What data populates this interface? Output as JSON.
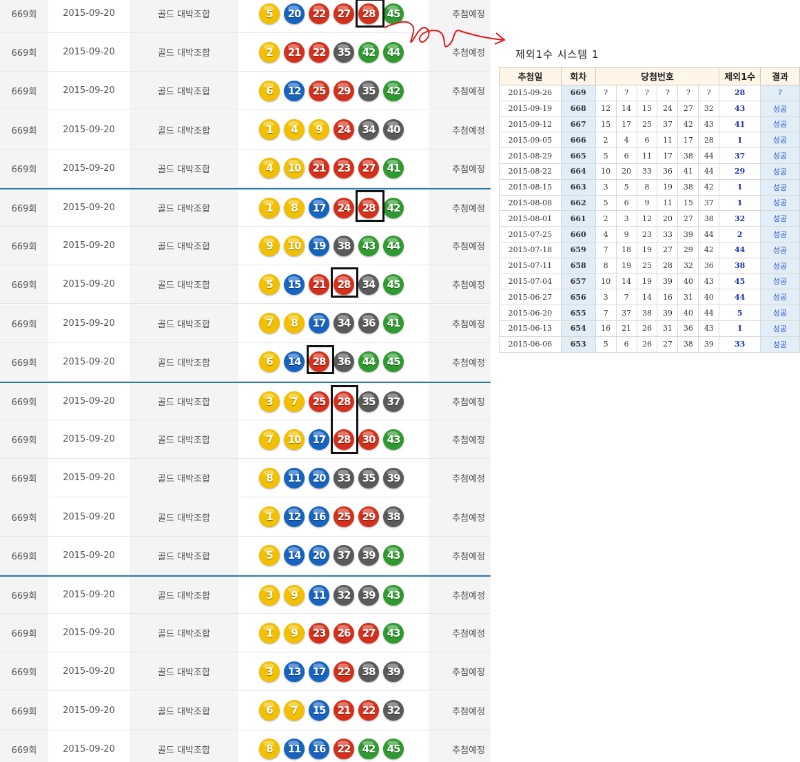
{
  "left_list": {
    "rows": [
      {
        "round": "669회",
        "date": "2015-09-20",
        "name": "골드 대박조합",
        "status": "추첨예정",
        "balls": [
          5,
          20,
          22,
          27,
          28,
          45
        ]
      },
      {
        "round": "669회",
        "date": "2015-09-20",
        "name": "골드 대박조합",
        "status": "추첨예정",
        "balls": [
          2,
          21,
          22,
          35,
          42,
          44
        ]
      },
      {
        "round": "669회",
        "date": "2015-09-20",
        "name": "골드 대박조합",
        "status": "추첨예정",
        "balls": [
          6,
          12,
          25,
          29,
          35,
          42
        ]
      },
      {
        "round": "669회",
        "date": "2015-09-20",
        "name": "골드 대박조합",
        "status": "추첨예정",
        "balls": [
          1,
          4,
          9,
          24,
          34,
          40
        ]
      },
      {
        "round": "669회",
        "date": "2015-09-20",
        "name": "골드 대박조합",
        "status": "추첨예정",
        "balls": [
          4,
          10,
          21,
          23,
          27,
          41
        ]
      },
      {
        "round": "669회",
        "date": "2015-09-20",
        "name": "골드 대박조합",
        "status": "추첨예정",
        "balls": [
          1,
          8,
          17,
          24,
          28,
          42
        ]
      },
      {
        "round": "669회",
        "date": "2015-09-20",
        "name": "골드 대박조합",
        "status": "추첨예정",
        "balls": [
          9,
          10,
          19,
          38,
          43,
          44
        ]
      },
      {
        "round": "669회",
        "date": "2015-09-20",
        "name": "골드 대박조합",
        "status": "추첨예정",
        "balls": [
          5,
          15,
          21,
          28,
          34,
          45
        ]
      },
      {
        "round": "669회",
        "date": "2015-09-20",
        "name": "골드 대박조합",
        "status": "추첨예정",
        "balls": [
          7,
          8,
          17,
          34,
          36,
          41
        ]
      },
      {
        "round": "669회",
        "date": "2015-09-20",
        "name": "골드 대박조합",
        "status": "추첨예정",
        "balls": [
          6,
          14,
          28,
          36,
          44,
          45
        ]
      },
      {
        "round": "669회",
        "date": "2015-09-20",
        "name": "골드 대박조합",
        "status": "추첨예정",
        "balls": [
          3,
          7,
          25,
          28,
          35,
          37
        ]
      },
      {
        "round": "669회",
        "date": "2015-09-20",
        "name": "골드 대박조합",
        "status": "추첨예정",
        "balls": [
          7,
          10,
          17,
          28,
          30,
          43
        ]
      },
      {
        "round": "669회",
        "date": "2015-09-20",
        "name": "골드 대박조합",
        "status": "추첨예정",
        "balls": [
          8,
          11,
          20,
          33,
          35,
          39
        ]
      },
      {
        "round": "669회",
        "date": "2015-09-20",
        "name": "골드 대박조합",
        "status": "추첨예정",
        "balls": [
          1,
          12,
          16,
          25,
          29,
          38
        ]
      },
      {
        "round": "669회",
        "date": "2015-09-20",
        "name": "골드 대박조합",
        "status": "추첨예정",
        "balls": [
          5,
          14,
          20,
          37,
          39,
          43
        ]
      },
      {
        "round": "669회",
        "date": "2015-09-20",
        "name": "골드 대박조합",
        "status": "추첨예정",
        "balls": [
          3,
          9,
          11,
          32,
          39,
          43
        ]
      },
      {
        "round": "669회",
        "date": "2015-09-20",
        "name": "골드 대박조합",
        "status": "추첨예정",
        "balls": [
          1,
          9,
          23,
          26,
          27,
          43
        ]
      },
      {
        "round": "669회",
        "date": "2015-09-20",
        "name": "골드 대박조합",
        "status": "추첨예정",
        "balls": [
          3,
          13,
          17,
          22,
          38,
          39
        ]
      },
      {
        "round": "669회",
        "date": "2015-09-20",
        "name": "골드 대박조합",
        "status": "추첨예정",
        "balls": [
          6,
          7,
          15,
          21,
          22,
          32
        ]
      },
      {
        "round": "669회",
        "date": "2015-09-20",
        "name": "골드 대박조합",
        "status": "추첨예정",
        "balls": [
          8,
          11,
          16,
          22,
          42,
          45
        ]
      }
    ]
  },
  "ball_colors": {
    "yellow": "#f2c000",
    "blue": "#1664c0",
    "red": "#d4301c",
    "gray": "#5a5a5a",
    "green": "#2f9a2f"
  },
  "panel": {
    "title": "제외1수 시스템 1",
    "headers": {
      "date": "추첨일",
      "round": "회차",
      "numbers": "당첨번호",
      "excluded": "제외1수",
      "result": "결과"
    },
    "rows": [
      {
        "date": "2015-09-26",
        "round": "669",
        "nums": [
          "?",
          "?",
          "?",
          "?",
          "?",
          "?"
        ],
        "excluded": "28",
        "result": "?"
      },
      {
        "date": "2015-09-19",
        "round": "668",
        "nums": [
          "12",
          "14",
          "15",
          "24",
          "27",
          "32"
        ],
        "excluded": "43",
        "result": "성공"
      },
      {
        "date": "2015-09-12",
        "round": "667",
        "nums": [
          "15",
          "17",
          "25",
          "37",
          "42",
          "43"
        ],
        "excluded": "41",
        "result": "성공"
      },
      {
        "date": "2015-09-05",
        "round": "666",
        "nums": [
          "2",
          "4",
          "6",
          "11",
          "17",
          "28"
        ],
        "excluded": "1",
        "result": "성공"
      },
      {
        "date": "2015-08-29",
        "round": "665",
        "nums": [
          "5",
          "6",
          "11",
          "17",
          "38",
          "44"
        ],
        "excluded": "37",
        "result": "성공"
      },
      {
        "date": "2015-08-22",
        "round": "664",
        "nums": [
          "10",
          "20",
          "33",
          "36",
          "41",
          "44"
        ],
        "excluded": "29",
        "result": "성공"
      },
      {
        "date": "2015-08-15",
        "round": "663",
        "nums": [
          "3",
          "5",
          "8",
          "19",
          "38",
          "42"
        ],
        "excluded": "1",
        "result": "성공"
      },
      {
        "date": "2015-08-08",
        "round": "662",
        "nums": [
          "5",
          "6",
          "9",
          "11",
          "15",
          "37"
        ],
        "excluded": "1",
        "result": "성공"
      },
      {
        "date": "2015-08-01",
        "round": "661",
        "nums": [
          "2",
          "3",
          "12",
          "20",
          "27",
          "38"
        ],
        "excluded": "32",
        "result": "성공"
      },
      {
        "date": "2015-07-25",
        "round": "660",
        "nums": [
          "4",
          "9",
          "23",
          "33",
          "39",
          "44"
        ],
        "excluded": "2",
        "result": "성공"
      },
      {
        "date": "2015-07-18",
        "round": "659",
        "nums": [
          "7",
          "18",
          "19",
          "27",
          "29",
          "42"
        ],
        "excluded": "44",
        "result": "성공"
      },
      {
        "date": "2015-07-11",
        "round": "658",
        "nums": [
          "8",
          "19",
          "25",
          "28",
          "32",
          "36"
        ],
        "excluded": "38",
        "result": "성공"
      },
      {
        "date": "2015-07-04",
        "round": "657",
        "nums": [
          "10",
          "14",
          "19",
          "39",
          "40",
          "43"
        ],
        "excluded": "45",
        "result": "성공"
      },
      {
        "date": "2015-06-27",
        "round": "656",
        "nums": [
          "3",
          "7",
          "14",
          "16",
          "31",
          "40"
        ],
        "excluded": "44",
        "result": "성공"
      },
      {
        "date": "2015-06-20",
        "round": "655",
        "nums": [
          "7",
          "37",
          "38",
          "39",
          "40",
          "44"
        ],
        "excluded": "5",
        "result": "성공"
      },
      {
        "date": "2015-06-13",
        "round": "654",
        "nums": [
          "16",
          "21",
          "26",
          "31",
          "36",
          "43"
        ],
        "excluded": "1",
        "result": "성공"
      },
      {
        "date": "2015-06-06",
        "round": "653",
        "nums": [
          "5",
          "6",
          "26",
          "27",
          "38",
          "39"
        ],
        "excluded": "33",
        "result": "성공"
      }
    ]
  }
}
